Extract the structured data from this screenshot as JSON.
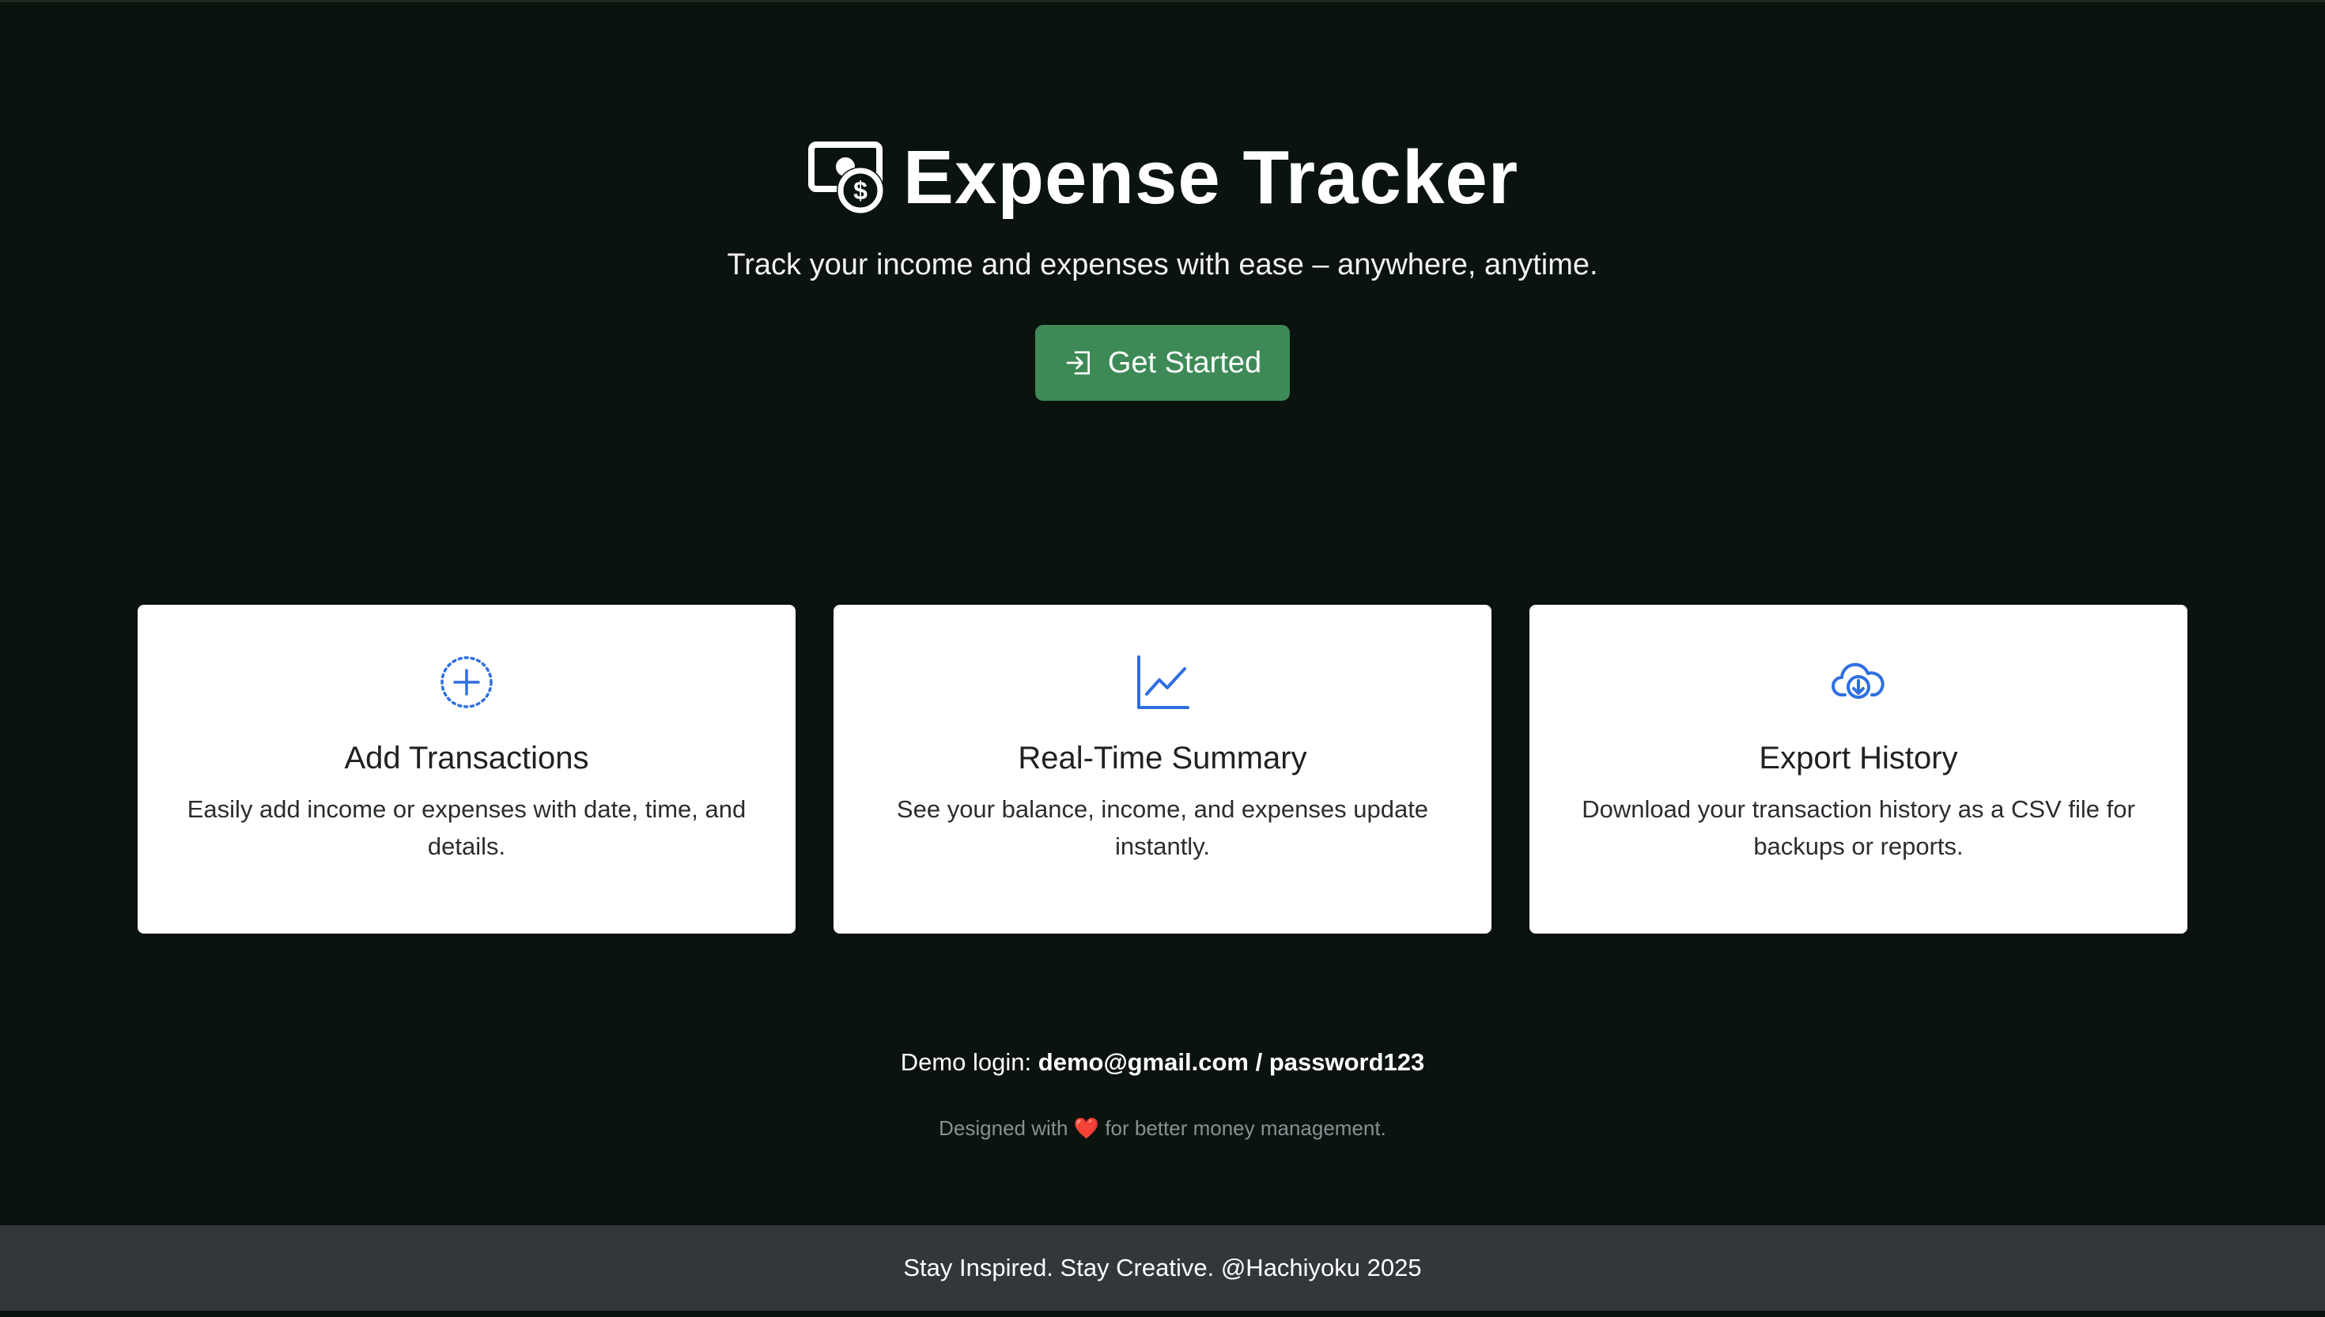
{
  "hero": {
    "title": "Expense Tracker",
    "subtitle": "Track your income and expenses with ease – anywhere, anytime.",
    "icon": "money-bill-dollar-icon",
    "cta_label": "Get Started",
    "cta_icon": "login-icon"
  },
  "features": [
    {
      "icon": "plus-circle-dotted-icon",
      "title": "Add Transactions",
      "description": "Easily add income or expenses with date, time, and details."
    },
    {
      "icon": "line-chart-icon",
      "title": "Real-Time Summary",
      "description": "See your balance, income, and expenses update instantly."
    },
    {
      "icon": "cloud-download-icon",
      "title": "Export History",
      "description": "Download your transaction history as a CSV file for backups or reports."
    }
  ],
  "demo": {
    "label": "Demo login:",
    "credentials": "demo@gmail.com / password123"
  },
  "designed": {
    "prefix": "Designed with",
    "heart": "❤️",
    "suffix": "for better money management."
  },
  "footer": {
    "text": "Stay Inspired. Stay Creative. @Hachiyoku 2025"
  },
  "colors": {
    "background": "#0a130e",
    "cta": "#3e8a57",
    "icon_blue": "#2f6fe0",
    "footer_bg": "#33373c"
  }
}
